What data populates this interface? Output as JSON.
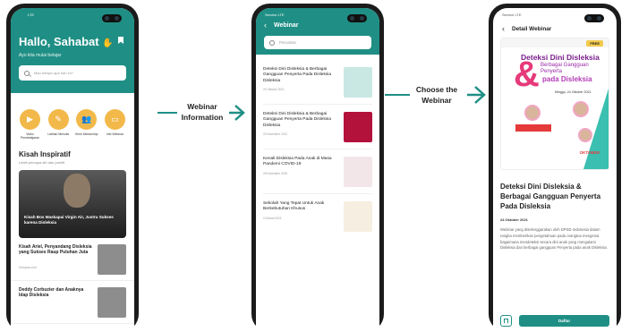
{
  "phone1": {
    "status": "LTE",
    "greeting": "Hallo, Sahabat",
    "subtitle": "Ayo kita mulai belajar",
    "search_placeholder": "Mau belajar apa hari ini?",
    "menu": [
      {
        "label": "Video Pembelajaran",
        "icon": "play-icon"
      },
      {
        "label": "Latihan Menulis",
        "icon": "pencil-icon"
      },
      {
        "label": "Kirim Mentorship",
        "icon": "people-icon"
      },
      {
        "label": "Info Webinar",
        "icon": "monitor-icon"
      }
    ],
    "kisah_title": "Kisah Inspiratif",
    "kisah_sub": "Lebih percaya diri dan positif",
    "hero_text": "Kisah Bos Maskapai Virgin Air, Justru Sukses karena Disleksia",
    "news": [
      {
        "title": "Kisah Ariel, Penyandang Disleksia yang Sukses Raup Puluhan Juta",
        "source": "Kompas.com"
      },
      {
        "title": "Deddy Corbuzier dan Anaknya Idap Disleksia",
        "source": ""
      }
    ]
  },
  "arrow1_label": "Webinar Information",
  "phone2": {
    "status": "Service LTE",
    "title": "Webinar",
    "search_placeholder": "Pencarian",
    "items": [
      {
        "title": "Deteksi Dini Disleksia & Berbagai Gangguan Penyerta Pada Disleksia Disleksia",
        "date": "24 Oktober 2021",
        "thumb_color": "#c9e8e4"
      },
      {
        "title": "Deteksi Dini Disleksia & Berbagai Gangguan Penyerta Pada Disleksia Disleksia",
        "date": "20 November 2021",
        "thumb_color": "#b3123a"
      },
      {
        "title": "Kenali Disleksia Pada Anak di Masa Pandemi COVID-19",
        "date": "28 November 2020",
        "thumb_color": "#f3e6e9"
      },
      {
        "title": "Sekolah Yang Tepat Untuk Anak Berkebutuhan Khusus",
        "date": "19 Maret 2022",
        "thumb_color": "#f6eee0"
      }
    ]
  },
  "arrow2_label": "Choose the Webinar",
  "phone3": {
    "status": "Service LTE",
    "title": "Detail Webinar",
    "poster": {
      "free": "FREE",
      "line1": "Deteksi Dini Disleksia",
      "line2": "Berbagai Gangguan Penyerta",
      "line3": "pada Disleksia",
      "date": "Minggu, 24 Oktober 2021",
      "october": "OKTOBER"
    },
    "webinar_title": "Deteksi Dini Disleksia & Berbagai Gangguan Penyerta Pada Disleksia",
    "date": "24 Oktober 2021",
    "description": "Webinar yang diselenggarakan oleh DPSD Indonesia dalam rangka memberikan pengetahuan pada orangtua mengenai bagaimana mendeteksi secara dini anak yang mengalami Disleksia dan berbagai gangguan Penyerta pada anak Disleksia.",
    "register_label": "Daftar"
  },
  "colors": {
    "teal": "#1f8f85",
    "accent": "#f2b94a"
  }
}
